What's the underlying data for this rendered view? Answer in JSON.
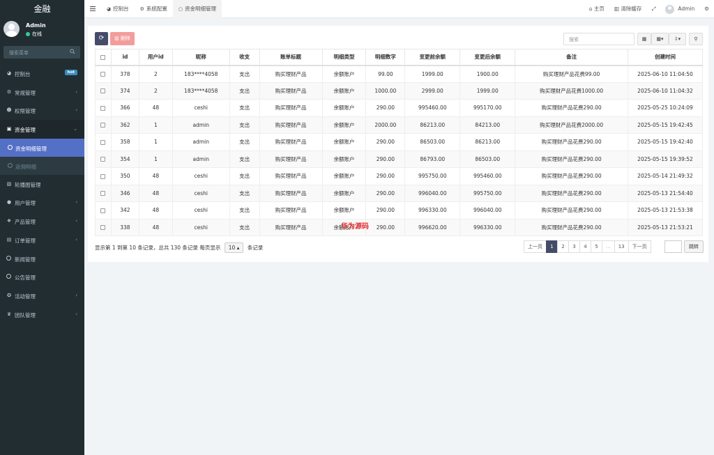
{
  "brand": "金融",
  "user": {
    "name": "Admin",
    "status": "在线"
  },
  "sidebar_search_placeholder": "搜索菜单",
  "menu": [
    {
      "label": "控制台",
      "icon": "dashboard-icon",
      "badge": "hot"
    },
    {
      "label": "常规管理",
      "icon": "cogs-icon",
      "arrow": "‹"
    },
    {
      "label": "权限管理",
      "icon": "group-icon",
      "arrow": "‹"
    },
    {
      "label": "资金管理",
      "icon": "money-icon",
      "arrow": "⌄"
    },
    {
      "label": "资金明细管理"
    },
    {
      "label": "返佣明细"
    },
    {
      "label": "轮播图管理",
      "icon": "image-icon"
    },
    {
      "label": "用户管理",
      "icon": "user-icon",
      "arrow": "‹"
    },
    {
      "label": "产品管理",
      "icon": "product-icon",
      "arrow": "‹"
    },
    {
      "label": "订单管理",
      "icon": "order-icon",
      "arrow": "‹"
    },
    {
      "label": "新闻管理",
      "icon": "circle-icon"
    },
    {
      "label": "公告管理",
      "icon": "circle-icon"
    },
    {
      "label": "活动管理",
      "icon": "activity-icon",
      "arrow": "‹"
    },
    {
      "label": "团队管理",
      "icon": "team-icon",
      "arrow": "‹"
    }
  ],
  "tabs": [
    {
      "label": "控制台"
    },
    {
      "label": "系统配置"
    },
    {
      "label": "资金明细管理"
    }
  ],
  "topright": {
    "home": "主页",
    "clear_cache": "清除缓存",
    "admin": "Admin"
  },
  "toolbar": {
    "delete": "删除",
    "search_placeholder": "搜索"
  },
  "columns": [
    "id",
    "用户id",
    "昵称",
    "收支",
    "账单标题",
    "明细类型",
    "明细数字",
    "变更前余额",
    "变更后余额",
    "备注",
    "创建时间"
  ],
  "rows": [
    [
      "378",
      "2",
      "183****4058",
      "支出",
      "购买理财产品",
      "余额账户",
      "99.00",
      "1999.00",
      "1900.00",
      "购买理财产品花费99.00",
      "2025-06-10 11:04:50"
    ],
    [
      "374",
      "2",
      "183****4058",
      "支出",
      "购买理财产品",
      "余额账户",
      "1000.00",
      "2999.00",
      "1999.00",
      "购买理财产品花费1000.00",
      "2025-06-10 11:04:32"
    ],
    [
      "366",
      "48",
      "ceshi",
      "支出",
      "购买理财产品",
      "余额账户",
      "290.00",
      "995460.00",
      "995170.00",
      "购买理财产品花费290.00",
      "2025-05-25 10:24:09"
    ],
    [
      "362",
      "1",
      "admin",
      "支出",
      "购买理财产品",
      "余额账户",
      "2000.00",
      "86213.00",
      "84213.00",
      "购买理财产品花费2000.00",
      "2025-05-15 19:42:45"
    ],
    [
      "358",
      "1",
      "admin",
      "支出",
      "购买理财产品",
      "余额账户",
      "290.00",
      "86503.00",
      "86213.00",
      "购买理财产品花费290.00",
      "2025-05-15 19:42:40"
    ],
    [
      "354",
      "1",
      "admin",
      "支出",
      "购买理财产品",
      "余额账户",
      "290.00",
      "86793.00",
      "86503.00",
      "购买理财产品花费290.00",
      "2025-05-15 19:39:52"
    ],
    [
      "350",
      "48",
      "ceshi",
      "支出",
      "购买理财产品",
      "余额账户",
      "290.00",
      "995750.00",
      "995460.00",
      "购买理财产品花费290.00",
      "2025-05-14 21:49:32"
    ],
    [
      "346",
      "48",
      "ceshi",
      "支出",
      "购买理财产品",
      "余额账户",
      "290.00",
      "996040.00",
      "995750.00",
      "购买理财产品花费290.00",
      "2025-05-13 21:54:40"
    ],
    [
      "342",
      "48",
      "ceshi",
      "支出",
      "购买理财产品",
      "余额账户",
      "290.00",
      "996330.00",
      "996040.00",
      "购买理财产品花费290.00",
      "2025-05-13 21:53:38"
    ],
    [
      "338",
      "48",
      "ceshi",
      "支出",
      "购买理财产品",
      "余额账户",
      "290.00",
      "996620.00",
      "996330.00",
      "购买理财产品花费290.00",
      "2025-05-13 21:53:21"
    ]
  ],
  "footer": {
    "info_prefix": "显示第 1 到第 10 条记录，总共 130 条记录 每页显示",
    "page_size": "10",
    "info_suffix": "条记录"
  },
  "pager": [
    "上一页",
    "1",
    "2",
    "3",
    "4",
    "5",
    "...",
    "13",
    "下一页"
  ],
  "pager_active": "1",
  "jump_label": "跳转",
  "watermark": "华为源码"
}
